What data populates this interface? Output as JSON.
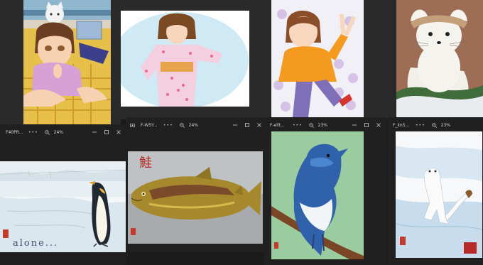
{
  "top_row": [
    {
      "name": "anime-girl-with-cat"
    },
    {
      "name": "girl-in-kimono"
    },
    {
      "name": "girl-peace-sign"
    },
    {
      "name": "white-ermine-painting"
    }
  ],
  "windows": [
    {
      "title": "F40PR...",
      "more": "•••",
      "zoom": "24%",
      "image": "penguin-alone",
      "caption": "alone..."
    },
    {
      "title": "F-W5Y...",
      "more": "•••",
      "zoom": "24%",
      "image": "salmon",
      "kanji": "鮭"
    },
    {
      "title": "F-ellt...",
      "more": "•••",
      "zoom": "23%",
      "image": "blue-bird"
    },
    {
      "title": "F_kn5...",
      "more": "•••",
      "zoom": "23%",
      "image": "ermine-snow"
    }
  ],
  "colors": {
    "window_bg": "#202020",
    "desktop_bg": "#1b1b1b",
    "text": "#d4d4d4"
  }
}
